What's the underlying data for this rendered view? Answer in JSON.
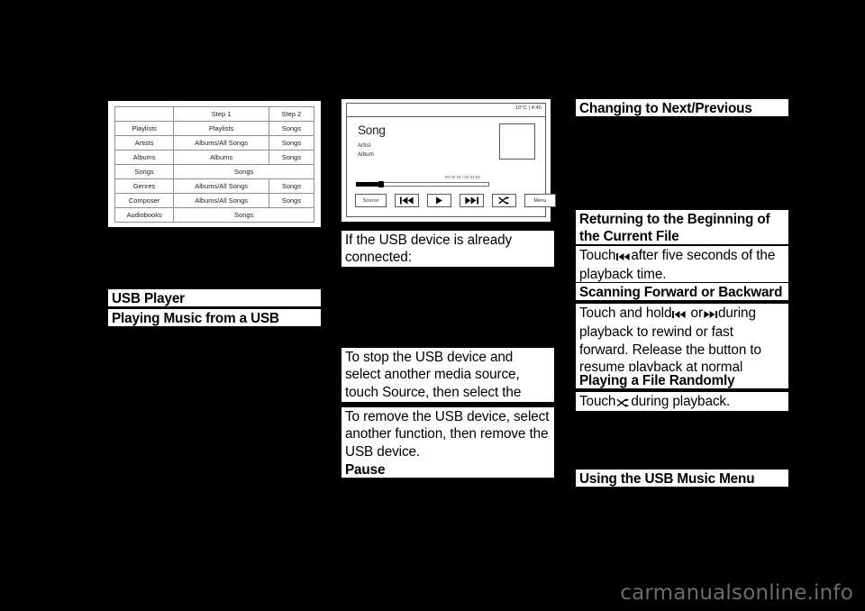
{
  "page": {
    "background": "#000000",
    "watermark": "carmanualsonline.info",
    "watermark_color": "#6b6b6b"
  },
  "figure_table": {
    "name": "music-browse-steps-table",
    "columns": [
      "",
      "Step 1",
      "Step 2"
    ],
    "rows": [
      {
        "category": "",
        "step1": "Step 1",
        "step2": "Step 2",
        "header": true
      },
      {
        "category": "Playlists",
        "step1": "Playlists",
        "step2": "Songs"
      },
      {
        "category": "Artists",
        "step1": "Albums/All Songs",
        "step2": "Songs"
      },
      {
        "category": "Albums",
        "step1": "Albums",
        "step2": "Songs"
      },
      {
        "category": "Songs",
        "step1": "Songs",
        "step2": null,
        "span": true
      },
      {
        "category": "Genres",
        "step1": "Albums/All Songs",
        "step2": "Songs"
      },
      {
        "category": "Composer",
        "step1": "Albums/All Songs",
        "step2": "Songs"
      },
      {
        "category": "Audiobooks",
        "step1": "Songs",
        "step2": null,
        "span": true
      }
    ]
  },
  "left_column": {
    "usb_player_heading": "USB Player",
    "playing_music_heading": "Playing Music from a USB Device"
  },
  "radio_figure": {
    "status": {
      "temperature": "10°C",
      "separator": "|",
      "clock": "4:45",
      "combined": "10°C | 4:45"
    },
    "now_playing": {
      "song": "Song",
      "artist": "Artist",
      "album": "Album"
    },
    "progress": {
      "time_display": "00:00:26 / 02:31:52",
      "percent": 19
    },
    "buttons": [
      {
        "label": "Source",
        "icon": null,
        "name": "source-button"
      },
      {
        "label": "",
        "icon": "previous-track-icon",
        "name": "previous-track-button"
      },
      {
        "label": "",
        "icon": "play-icon",
        "name": "play-button"
      },
      {
        "label": "",
        "icon": "next-track-icon",
        "name": "next-track-button"
      },
      {
        "label": "",
        "icon": "shuffle-icon",
        "name": "shuffle-button"
      },
      {
        "label": "Menu",
        "icon": null,
        "name": "menu-button"
      }
    ]
  },
  "center_column": {
    "already_connected": "If the USB device is already connected:",
    "stop_usb": "To stop the USB device and select another media source, touch Source, then select the other source.",
    "remove_usb": "To remove the USB device, select another function, then remove the USB device.",
    "pause_heading": "Pause"
  },
  "right_column": {
    "next_previous_heading": "Changing to Next/Previous Files",
    "returning_heading": "Returning to the Beginning of the Current File",
    "returning_body_before": "Touch",
    "returning_body_after": "after five seconds of the playback time.",
    "scanning_heading": "Scanning Forward or Backward",
    "scanning_body_before": "Touch and hold",
    "scanning_body_middle": "or",
    "scanning_body_after": "during playback to rewind or fast forward. Release the button to resume playback at normal speed.",
    "random_heading": "Playing a File Randomly",
    "random_body_before": "Touch",
    "random_body_after": "during playback.",
    "usb_menu_heading": "Using the USB Music Menu"
  }
}
